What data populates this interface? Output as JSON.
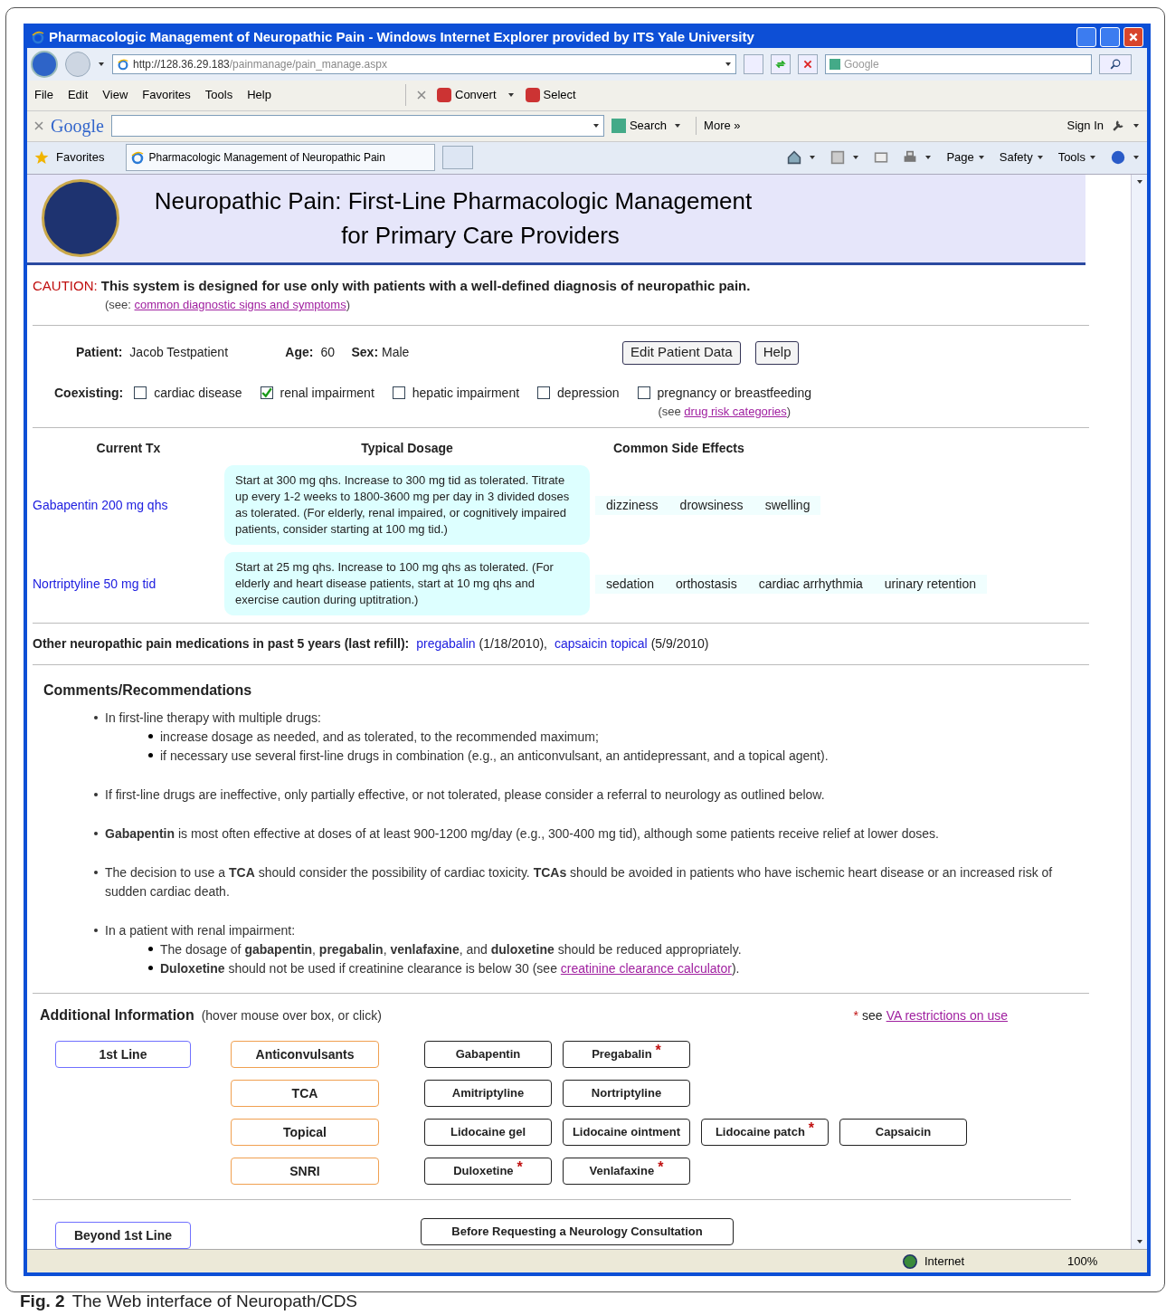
{
  "window": {
    "title": "Pharmacologic Management of Neuropathic Pain - Windows Internet Explorer provided by ITS Yale University"
  },
  "address_bar": {
    "url_host": "http://128.36.29.183",
    "url_path": "/painmanage/pain_manage.aspx",
    "search_placeholder": "Google"
  },
  "menu": [
    "File",
    "Edit",
    "View",
    "Favorites",
    "Tools",
    "Help"
  ],
  "menu_tools": [
    {
      "label": "Convert"
    },
    {
      "label": "Select"
    }
  ],
  "google_bar": {
    "logo": "Google",
    "search": "Search",
    "more": "More »",
    "sign_in": "Sign In"
  },
  "favorites_bar": {
    "favorites": "Favorites",
    "tab": "Pharmacologic Management of Neuropathic Pain",
    "commands": [
      "Page",
      "Safety",
      "Tools"
    ]
  },
  "page": {
    "title_line1": "Neuropathic Pain: First-Line Pharmacologic Management",
    "title_line2": "for Primary Care Providers",
    "caution_label": "CAUTION:",
    "caution_text": "This system is designed for use only with patients with a well-defined diagnosis of neuropathic pain.",
    "see_prefix": "(see:",
    "see_link": "common diagnostic signs and symptoms",
    "see_suffix": ")",
    "patient": {
      "patient_label": "Patient:",
      "patient_name": "Jacob Testpatient",
      "age_label": "Age:",
      "age": "60",
      "sex_label": "Sex:",
      "sex": "Male"
    },
    "buttons": [
      "Edit Patient Data",
      "Help"
    ],
    "coexisting_label": "Coexisting:",
    "coexisting": [
      {
        "label": "cardiac disease",
        "checked": false
      },
      {
        "label": "renal impairment",
        "checked": true
      },
      {
        "label": "hepatic impairment",
        "checked": false
      },
      {
        "label": "depression",
        "checked": false
      },
      {
        "label": "pregnancy or breastfeeding",
        "checked": false,
        "note_prefix": "(see",
        "note_link": "drug risk categories",
        "note_suffix": ")"
      }
    ],
    "tx_columns": [
      "Current Tx",
      "Typical Dosage",
      "Common Side Effects"
    ],
    "tx_rows": [
      {
        "drug": "Gabapentin 200 mg qhs",
        "dosage": "Start at 300 mg qhs. Increase to 300 mg tid as tolerated. Titrate up every 1-2 weeks to 1800-3600 mg per day in 3 divided doses as tolerated. (For elderly, renal impaired, or cognitively impaired patients, consider starting at 100 mg tid.)",
        "side_effects": [
          "dizziness",
          "drowsiness",
          "swelling"
        ]
      },
      {
        "drug": "Nortriptyline 50 mg tid",
        "dosage": "Start at 25 mg qhs. Increase to 100 mg qhs as tolerated. (For elderly and heart disease patients, start at 10 mg qhs and exercise caution during uptitration.)",
        "side_effects": [
          "sedation",
          "orthostasis",
          "cardiac arrhythmia",
          "urinary retention"
        ]
      }
    ],
    "other_meds_label": "Other neuropathic pain medications in past 5 years (last refill):",
    "other_meds": [
      {
        "drug": "pregabalin",
        "date": "(1/18/2010),"
      },
      {
        "drug": "capsaicin topical",
        "date": "(5/9/2010)"
      }
    ],
    "comments_title": "Comments/Recommendations",
    "comments": [
      {
        "text": "In first-line therapy with multiple drugs:",
        "children": [
          {
            "text": "increase dosage as needed, and as tolerated, to the recommended maximum;"
          },
          {
            "text": "if necessary use several first-line drugs in combination (e.g., an anticonvulsant, an antidepressant, and a topical agent)."
          }
        ]
      },
      {
        "text": "If first-line drugs are ineffective, only partially effective, or not tolerated, please consider a referral to neurology as outlined below."
      },
      {
        "text": "**Gabapentin** is most often effective at doses of at least 900-1200 mg/day (e.g., 300-400 mg tid), although some patients receive relief at lower doses."
      },
      {
        "text": "The decision to use a **TCA** should consider the possibility of cardiac toxicity. **TCAs** should be avoided in patients who have ischemic heart disease or an increased risk of sudden cardiac death."
      },
      {
        "text": "In a patient with renal impairment:",
        "children": [
          {
            "text": "The dosage of **gabapentin**, **pregabalin**, **venlafaxine**, and **duloxetine** should be reduced appropriately."
          },
          {
            "text": "**Duloxetine** should not be used if creatinine clearance is below 30 (see ",
            "link": "creatinine clearance calculator",
            "suffix": ")."
          }
        ]
      }
    ],
    "additional_title": "Additional Information",
    "additional_hint": "(hover mouse over box, or click)",
    "restriction_mark": "*",
    "restriction_text": "see",
    "restriction_link": "VA restrictions on use",
    "first_line": "1st Line",
    "classes": [
      {
        "name": "Anticonvulsants",
        "drugs": [
          {
            "name": "Gabapentin",
            "restricted": false
          },
          {
            "name": "Pregabalin",
            "restricted": true
          }
        ]
      },
      {
        "name": "TCA",
        "drugs": [
          {
            "name": "Amitriptyline",
            "restricted": false
          },
          {
            "name": "Nortriptyline",
            "restricted": false
          }
        ]
      },
      {
        "name": "Topical",
        "drugs": [
          {
            "name": "Lidocaine gel",
            "restricted": false
          },
          {
            "name": "Lidocaine ointment",
            "restricted": false
          },
          {
            "name": "Lidocaine patch",
            "restricted": true
          },
          {
            "name": "Capsaicin",
            "restricted": false
          }
        ]
      },
      {
        "name": "SNRI",
        "drugs": [
          {
            "name": "Duloxetine",
            "restricted": true
          },
          {
            "name": "Venlafaxine",
            "restricted": true
          }
        ]
      }
    ],
    "beyond_first_line": "Beyond 1st Line",
    "neurology_button": "Before Requesting a Neurology Consultation"
  },
  "status_bar": {
    "zone": "Internet",
    "zoom": "100%"
  },
  "caption": {
    "label": "Fig. 2",
    "text": "The Web interface of Neuropath/CDS"
  }
}
